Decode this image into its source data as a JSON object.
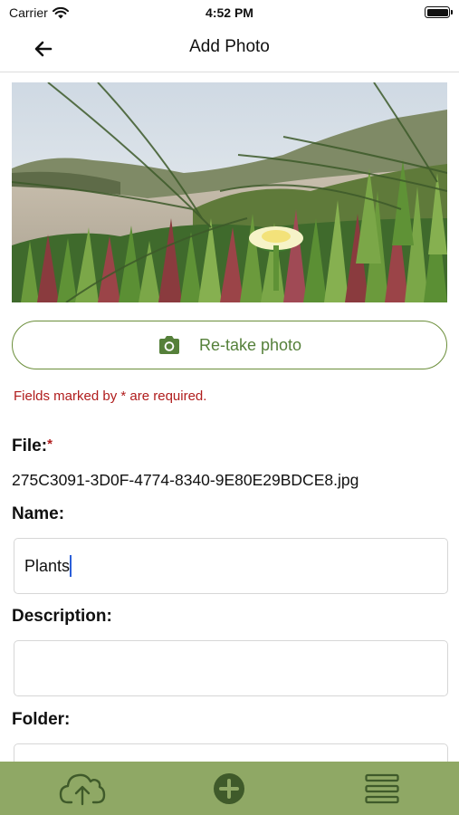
{
  "status": {
    "carrier": "Carrier",
    "time": "4:52 PM"
  },
  "nav": {
    "title": "Add Photo",
    "back_icon": "arrow-left-icon"
  },
  "photo": {
    "subject": "Photo of a yellow-white ice plant flower among green succulents and dune grass"
  },
  "retake": {
    "label": "Re-take photo",
    "icon": "camera-icon"
  },
  "form": {
    "required_note": "Fields marked by * are required.",
    "file_label": "File:",
    "file_required": "*",
    "file_value": "275C3091-3D0F-4774-8340-9E80E29BDCE8.jpg",
    "name_label": "Name:",
    "name_value": "Plants",
    "description_label": "Description:",
    "description_value": "",
    "folder_label": "Folder:",
    "folder_value": ""
  },
  "tab_bar": {
    "items": [
      {
        "icon": "cloud-upload-icon"
      },
      {
        "icon": "add-circle-icon"
      },
      {
        "icon": "menu-icon"
      }
    ]
  },
  "colors": {
    "accent_green": "#55803a",
    "tab_bar_bg": "#8fa865",
    "required_red": "#b01c1c"
  }
}
